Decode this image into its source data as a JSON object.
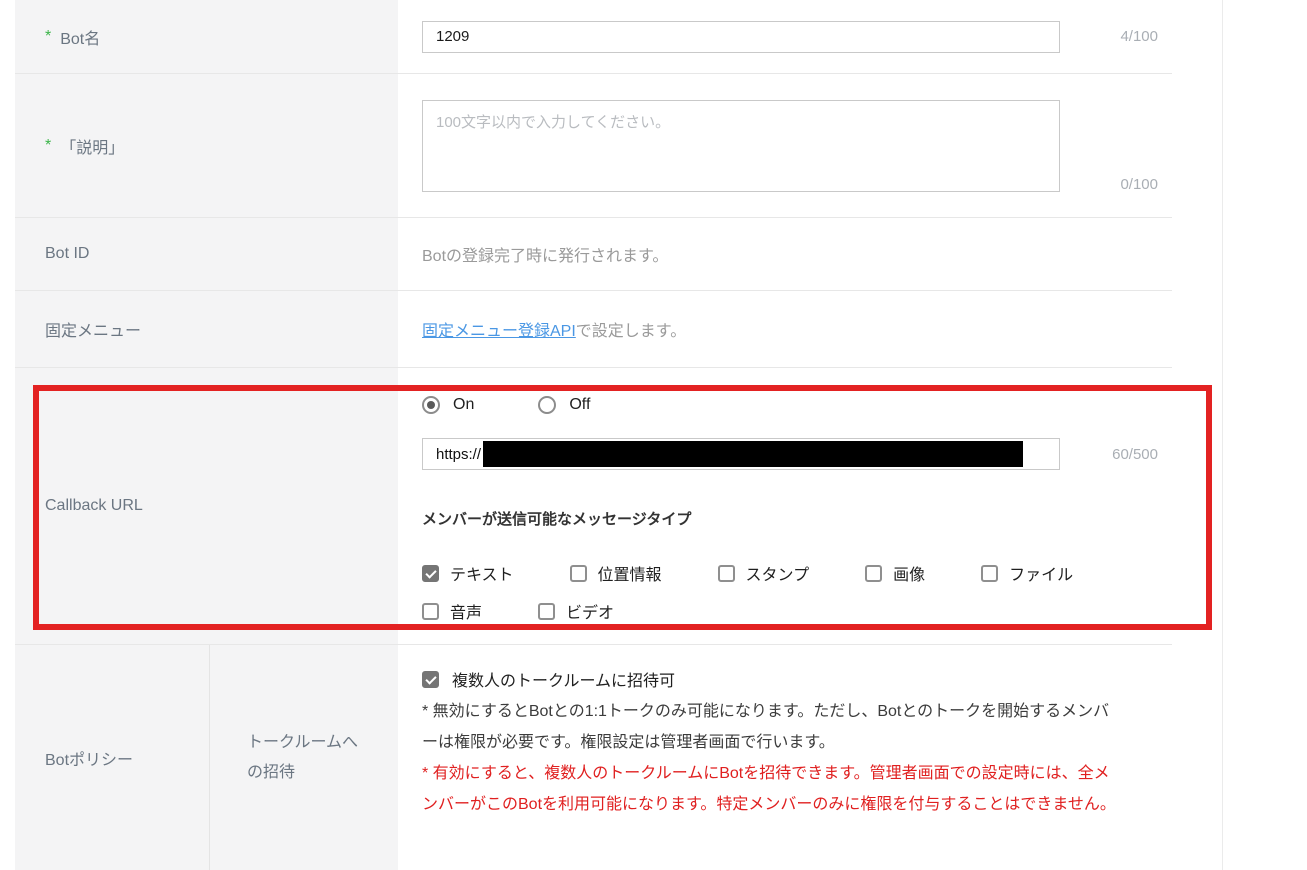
{
  "colors": {
    "annotation_red": "#e32222",
    "link_blue": "#4a97e4",
    "required_green": "#3cb54a"
  },
  "rows": {
    "bot_name": {
      "required_mark": "*",
      "label": "Bot名",
      "value": "1209",
      "counter": "4/100"
    },
    "description": {
      "required_mark": "*",
      "label": "「説明」",
      "placeholder": "100文字以内で入力してください。",
      "counter": "0/100"
    },
    "bot_id": {
      "label": "Bot ID",
      "note": "Botの登録完了時に発行されます。"
    },
    "fixed_menu": {
      "label": "固定メニュー",
      "link_text": "固定メニュー登録API",
      "suffix": " で設定します。"
    },
    "callback_url": {
      "label": "Callback URL",
      "radio_on": "On",
      "radio_off": "Off",
      "radio_selected": "On",
      "url_prefix": "https://",
      "url_redacted": true,
      "counter": "60/500",
      "message_types_heading": "メンバーが送信可能なメッセージタイプ",
      "message_types": [
        {
          "label": "テキスト",
          "checked": true
        },
        {
          "label": "位置情報",
          "checked": false
        },
        {
          "label": "スタンプ",
          "checked": false
        },
        {
          "label": "画像",
          "checked": false
        },
        {
          "label": "ファイル",
          "checked": false
        },
        {
          "label": "音声",
          "checked": false
        },
        {
          "label": "ビデオ",
          "checked": false
        }
      ]
    },
    "bot_policy": {
      "label": "Botポリシー",
      "sub_label": "トークルームへの招待",
      "checkbox_label": "複数人のトークルームに招待可",
      "checkbox_checked": true,
      "note_gray": "* 無効にするとBotとの1:1トークのみ可能になります。ただし、Botとのトークを開始するメンバーは権限が必要です。権限設定は管理者画面で行います。",
      "note_red": "* 有効にすると、複数人のトークルームにBotを招待できます。管理者画面での設定時には、全メンバーがこのBotを利用可能になります。特定メンバーのみに権限を付与することはできません。"
    }
  }
}
